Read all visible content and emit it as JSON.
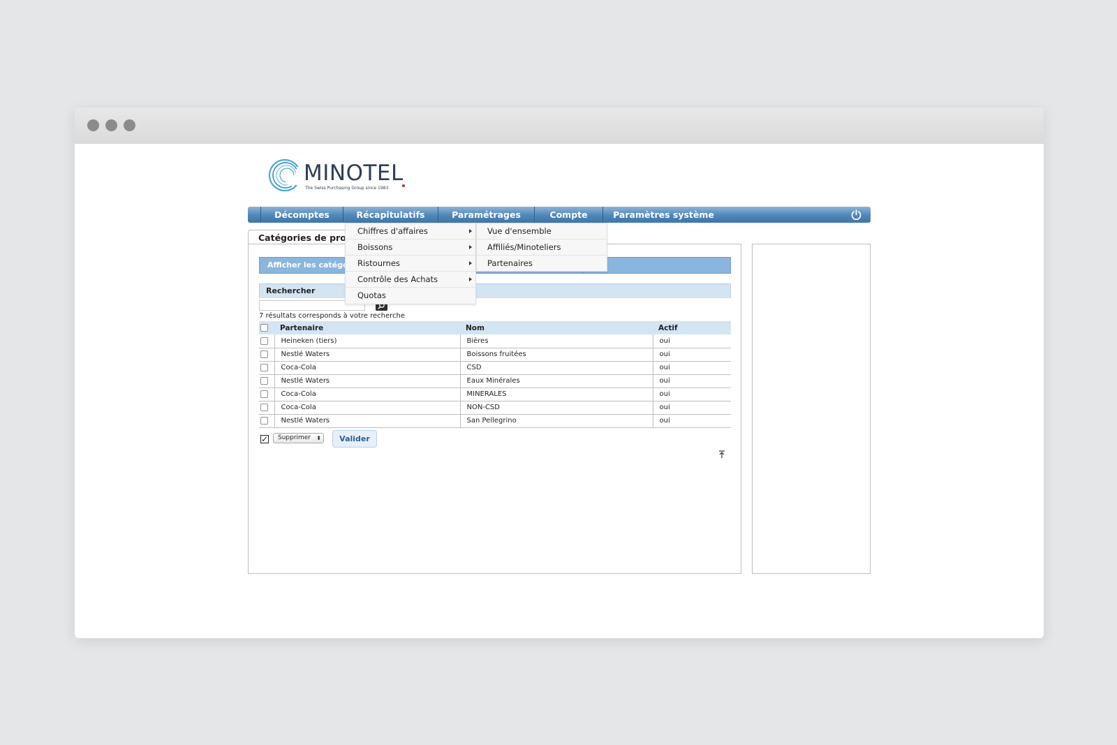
{
  "brand": {
    "name": "MINOTEL",
    "tagline": "The Swiss Purchasing Group since 1983"
  },
  "nav": {
    "items": [
      {
        "label": "Décomptes"
      },
      {
        "label": "Récapitulatifs"
      },
      {
        "label": "Paramétrages"
      },
      {
        "label": "Compte"
      },
      {
        "label": "Paramètres système"
      }
    ],
    "power_icon": "power-icon"
  },
  "dropdown": {
    "items": [
      {
        "label": "Chiffres d'affaires",
        "has_submenu": true
      },
      {
        "label": "Boissons",
        "has_submenu": true
      },
      {
        "label": "Ristournes",
        "has_submenu": true
      },
      {
        "label": "Contrôle des Achats",
        "has_submenu": true
      },
      {
        "label": "Quotas",
        "has_submenu": false
      }
    ],
    "submenu": [
      {
        "label": "Vue d'ensemble"
      },
      {
        "label": "Affiliés/Minoteliers"
      },
      {
        "label": "Partenaires"
      }
    ]
  },
  "panel": {
    "tab_title": "Catégories de produits",
    "afficher_label": "Afficher les catégories",
    "search_label": "Rechercher",
    "search_value": "",
    "results_text": "7 résultats corresponds à votre recherche"
  },
  "table": {
    "headers": [
      "Partenaire",
      "Nom",
      "Actif"
    ],
    "rows": [
      [
        "Heineken (tiers)",
        "Bières",
        "oui"
      ],
      [
        "Nestlé Waters",
        "Boissons fruitées",
        "oui"
      ],
      [
        "Coca-Cola",
        "CSD",
        "oui"
      ],
      [
        "Nestlé Waters",
        "Eaux Minérales",
        "oui"
      ],
      [
        "Coca-Cola",
        "MINERALES",
        "oui"
      ],
      [
        "Coca-Cola",
        "NON-CSD",
        "oui"
      ],
      [
        "Nestlé Waters",
        "San Pellegrino",
        "oui"
      ]
    ]
  },
  "actions": {
    "select_value": "Supprimer",
    "submit_label": "Valider"
  },
  "colors": {
    "nav_blue": "#4f86b7",
    "header_light": "#d3e4f3",
    "bar_blue": "#8ab5dc",
    "logo_navy": "#2f3d55",
    "logo_red": "#d0213b"
  }
}
